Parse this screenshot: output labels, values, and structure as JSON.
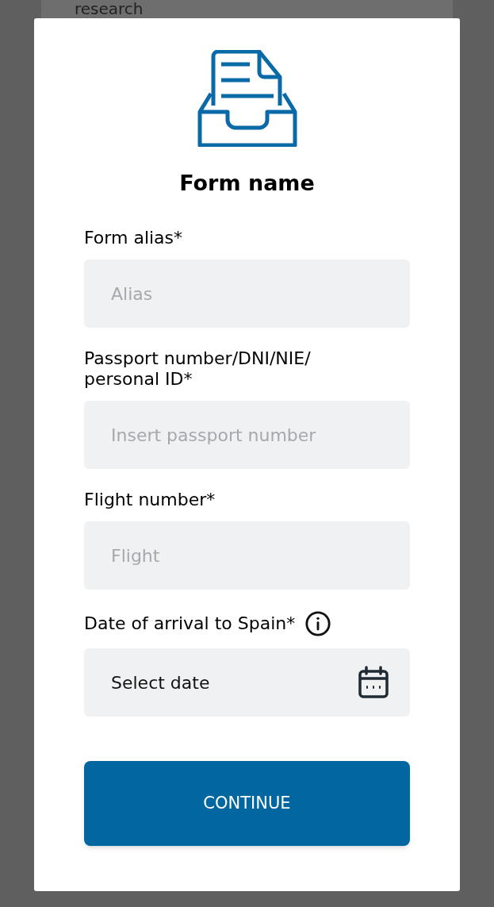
{
  "background": {
    "text": "research"
  },
  "dialog": {
    "title": "Form name",
    "fields": [
      {
        "kind": "text",
        "label": "Form alias*",
        "placeholder": "Alias",
        "info": false
      },
      {
        "kind": "text",
        "label": "Passport number/DNI/NIE/ personal ID*",
        "placeholder": "Insert passport number",
        "info": false
      },
      {
        "kind": "text",
        "label": "Flight number*",
        "placeholder": "Flight",
        "info": false
      },
      {
        "kind": "date",
        "label": "Date of arrival to Spain*",
        "value": "Select date",
        "info": true
      }
    ],
    "button": "CONTINUE"
  }
}
